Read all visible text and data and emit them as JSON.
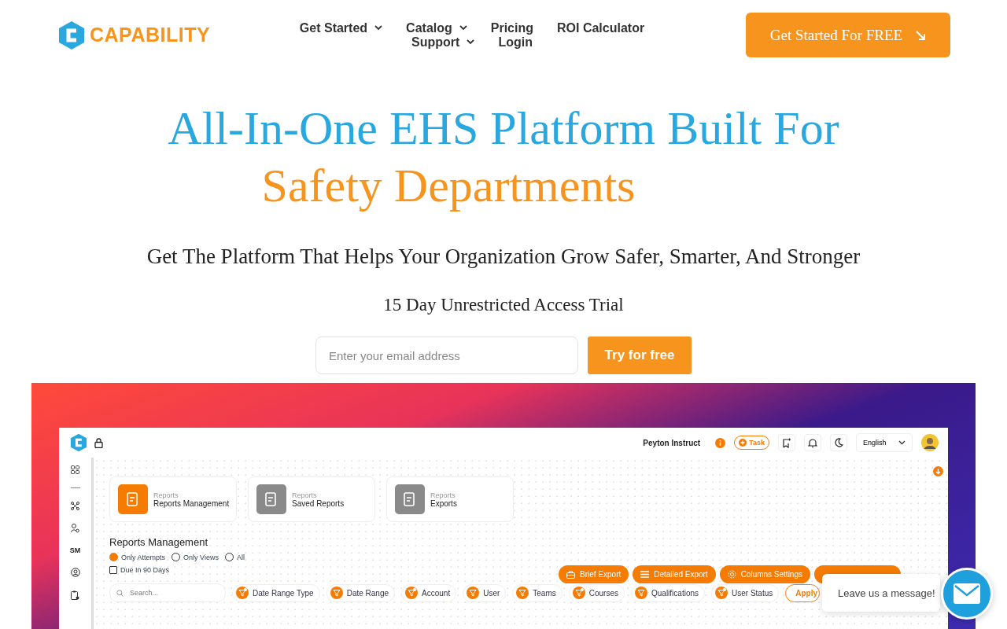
{
  "header": {
    "logo": "CAPABILITY",
    "nav_rows": [
      [
        {
          "label": "Get Started",
          "has_menu": true
        },
        {
          "label": "Catalog",
          "has_menu": true
        },
        {
          "label": "Pricing",
          "has_menu": false
        },
        {
          "label": "ROI Calculator",
          "has_menu": false
        }
      ],
      [
        {
          "label": "Support",
          "has_menu": true
        },
        {
          "label": "Login",
          "has_menu": false
        }
      ]
    ],
    "cta": "Get Started For FREE"
  },
  "hero": {
    "title_line_1": "All-In-One EHS Platform Built For",
    "title_line_2": "Safety Departments",
    "subtitle": "Get The Platform That Helps Your Organization Grow Safer, Smarter, And Stronger",
    "trial_note": "15 Day Unrestricted Access Trial",
    "email": {
      "placeholder": "Enter your email address"
    },
    "submit": "Try for free"
  },
  "app_preview": {
    "topbar": {
      "user_name": "Peyton Instruct",
      "task_button": "Task",
      "language": "English"
    },
    "sidebar_label": "SM",
    "cards": [
      {
        "category": "Reports",
        "title": "Reports Management",
        "selected": true
      },
      {
        "category": "Reports",
        "title": "Saved Reports",
        "selected": false
      },
      {
        "category": "Reports",
        "title": "Exports",
        "selected": false
      }
    ],
    "section_title": "Reports Management",
    "radios": [
      {
        "label": "Only Attempts",
        "selected": true
      },
      {
        "label": "Only Views",
        "selected": false
      },
      {
        "label": "All",
        "selected": false
      }
    ],
    "checkbox": {
      "label": "Due In 90 Days",
      "checked": false
    },
    "export_buttons": [
      {
        "label": "Brief Export",
        "kind": "brief"
      },
      {
        "label": "Detailed Export",
        "kind": "detailed"
      },
      {
        "label": "Columns Settings",
        "kind": "columns"
      }
    ],
    "search": {
      "placeholder": "Search..."
    },
    "filters": [
      {
        "label": "Date Range Type",
        "active": true
      },
      {
        "label": "Date Range",
        "active": false
      },
      {
        "label": "Account",
        "active": true
      },
      {
        "label": "User",
        "active": false
      },
      {
        "label": "Teams",
        "active": false
      },
      {
        "label": "Courses",
        "active": true
      },
      {
        "label": "Qualifications",
        "active": false
      },
      {
        "label": "User Status",
        "active": true
      }
    ],
    "apply_button": "Apply"
  },
  "chat": {
    "message": "Leave us a message!"
  }
}
